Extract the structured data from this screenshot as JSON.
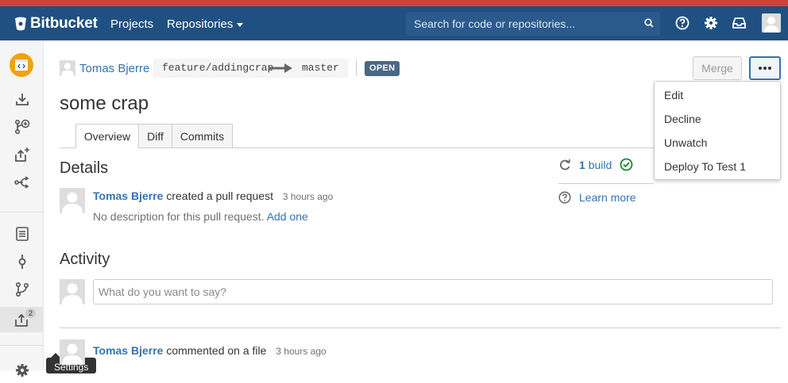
{
  "app": {
    "name": "Bitbucket"
  },
  "nav": {
    "projects_label": "Projects",
    "repositories_label": "Repositories",
    "search_placeholder": "Search for code or repositories..."
  },
  "sidebar": {
    "pull_requests_count": "2",
    "settings_tooltip": "Settings",
    "icons": [
      "download-icon",
      "create-branch-icon",
      "create-pull-request-icon",
      "fork-icon",
      "source-icon",
      "commits-icon",
      "branches-icon",
      "pull-requests-icon",
      "settings-icon"
    ]
  },
  "pr": {
    "author": "Tomas Bjerre",
    "source_branch": "feature/addingcrap",
    "target_branch": "master",
    "status": "OPEN",
    "title": "some crap",
    "merge_label": "Merge"
  },
  "more_menu": {
    "items": [
      "Edit",
      "Decline",
      "Unwatch",
      "Deploy To Test 1"
    ]
  },
  "tabs": [
    "Overview",
    "Diff",
    "Commits"
  ],
  "details": {
    "heading": "Details",
    "author": "Tomas Bjerre",
    "action": "created a pull request",
    "time": "3 hours ago",
    "no_description": "No description for this pull request.",
    "add_one": "Add one"
  },
  "builds": {
    "count": "1",
    "label": "build",
    "learn_more": "Learn more"
  },
  "activity": {
    "heading": "Activity",
    "comment_placeholder": "What do you want to say?",
    "entry_author": "Tomas Bjerre",
    "entry_action": "commented on a file",
    "entry_time": "3 hours ago"
  },
  "colors": {
    "header_bg": "#205081",
    "top_strip": "#d04437",
    "link": "#3572b0",
    "status_badge": "#4a6785",
    "success": "#14892c"
  }
}
